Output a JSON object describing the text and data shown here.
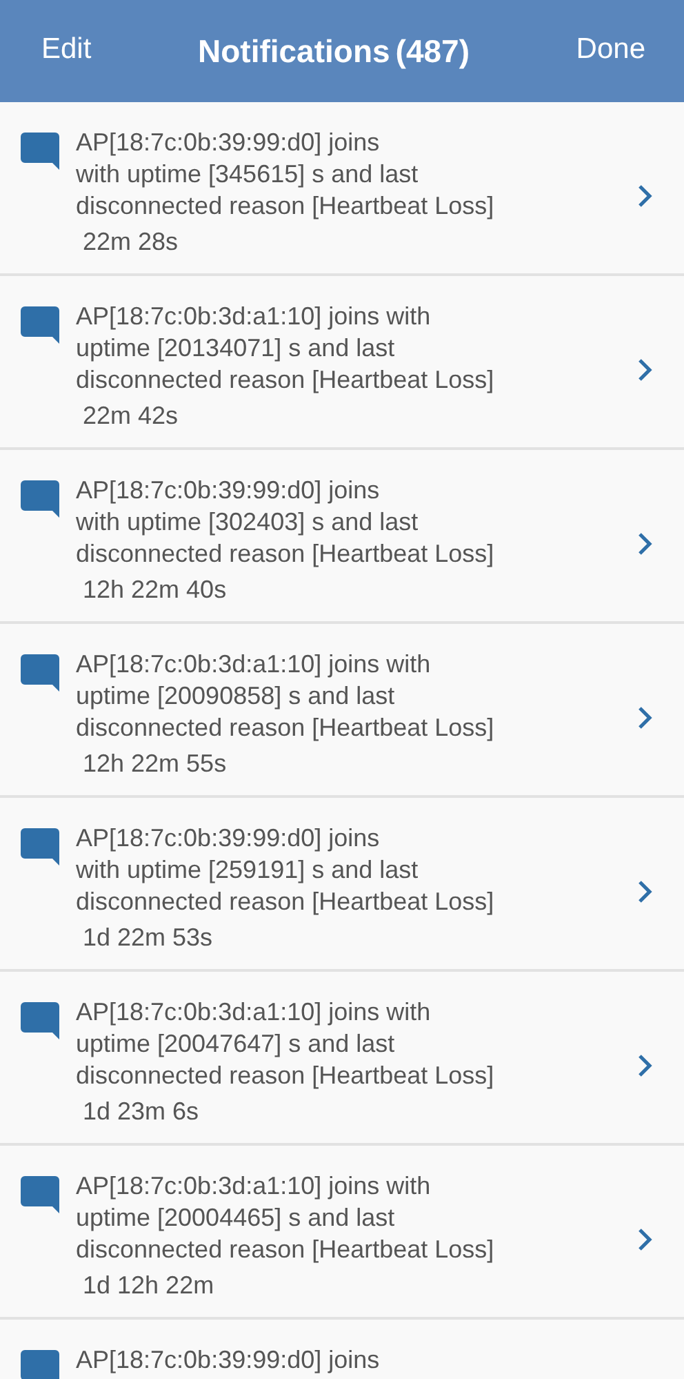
{
  "header": {
    "left_button": "Edit",
    "title": "Notifications",
    "count": "(487)",
    "right_button": "Done"
  },
  "notifications": [
    {
      "lines": [
        "AP[18:7c:0b:39:99:d0] joins",
        "with uptime [345615] s and last",
        "disconnected reason [Heartbeat Loss]"
      ],
      "time": "22m 28s"
    },
    {
      "lines": [
        "AP[18:7c:0b:3d:a1:10] joins with",
        "uptime [20134071] s and last",
        "disconnected reason [Heartbeat Loss]"
      ],
      "time": "22m 42s"
    },
    {
      "lines": [
        "AP[18:7c:0b:39:99:d0] joins",
        "with uptime [302403] s and last",
        "disconnected reason [Heartbeat Loss]"
      ],
      "time": "12h 22m 40s"
    },
    {
      "lines": [
        "AP[18:7c:0b:3d:a1:10] joins with",
        "uptime [20090858] s and last",
        "disconnected reason [Heartbeat Loss]"
      ],
      "time": "12h 22m 55s"
    },
    {
      "lines": [
        "AP[18:7c:0b:39:99:d0] joins",
        "with uptime [259191] s and last",
        "disconnected reason [Heartbeat Loss]"
      ],
      "time": "1d 22m 53s"
    },
    {
      "lines": [
        "AP[18:7c:0b:3d:a1:10] joins with",
        "uptime [20047647] s and last",
        "disconnected reason [Heartbeat Loss]"
      ],
      "time": "1d 23m 6s"
    },
    {
      "lines": [
        "AP[18:7c:0b:3d:a1:10] joins with",
        "uptime [20004465] s and last",
        "disconnected reason [Heartbeat Loss]"
      ],
      "time": "1d 12h 22m"
    },
    {
      "lines": [
        "AP[18:7c:0b:39:99:d0] joins"
      ]
    }
  ]
}
